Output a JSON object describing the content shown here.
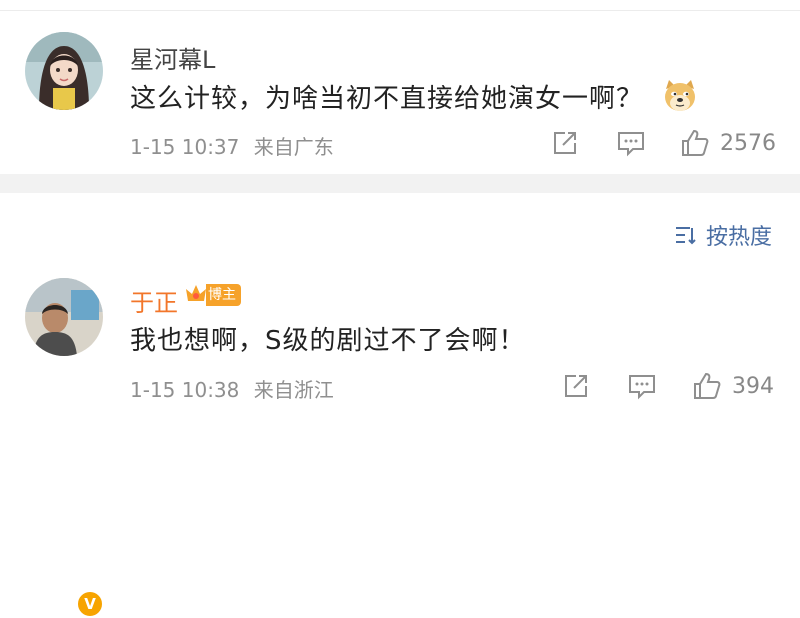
{
  "comments": [
    {
      "username": "星河幕L",
      "text": "这么计较，为啥当初不直接给她演女一啊？",
      "emoji": "doge-emoji",
      "time": "1-15 10:37",
      "location": "来自广东",
      "likes": "2576",
      "icons": [
        "share-icon",
        "comment-icon",
        "like-icon"
      ]
    },
    {
      "username": "于正",
      "badge": "博主",
      "text": "我也想啊，S级的剧过不了会啊！",
      "time": "1-15 10:38",
      "location": "来自浙江",
      "likes": "394",
      "verified": "V",
      "icons": [
        "share-icon",
        "comment-icon",
        "like-icon"
      ]
    }
  ],
  "sort": {
    "label": "按热度",
    "icon": "sort-icon"
  },
  "colors": {
    "username_blogger": "#f2762a",
    "sort_label": "#4a6ea3",
    "meta_text": "#8f8f8f",
    "badge": "#f6a22a",
    "separator": "#f2f2f2"
  }
}
